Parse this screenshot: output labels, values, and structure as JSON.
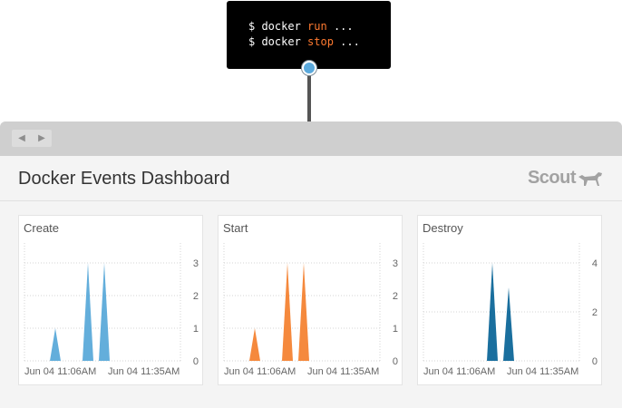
{
  "terminal": {
    "lines": [
      {
        "prompt": "$ docker",
        "command": "run",
        "suffix": "..."
      },
      {
        "prompt": "$ docker",
        "command": "stop",
        "suffix": "..."
      }
    ]
  },
  "window": {
    "nav": {
      "back_icon": "triangle-left-icon",
      "forward_icon": "triangle-right-icon"
    },
    "page_title": "Docker Events Dashboard",
    "logo_text": "Scout",
    "logo_icon": "dog-icon"
  },
  "chart_data": [
    {
      "type": "area",
      "title": "Create",
      "color": "#63aedb",
      "x_tick_labels": [
        "Jun 04 11:06AM",
        "Jun 04 11:35AM"
      ],
      "y_ticks": [
        0,
        1,
        2,
        3
      ],
      "ylim": [
        0,
        3
      ],
      "spikes": [
        1,
        3,
        3
      ]
    },
    {
      "type": "area",
      "title": "Start",
      "color": "#f5893d",
      "x_tick_labels": [
        "Jun 04 11:06AM",
        "Jun 04 11:35AM"
      ],
      "y_ticks": [
        0,
        1,
        2,
        3
      ],
      "ylim": [
        0,
        3
      ],
      "spikes": [
        1,
        3,
        3
      ]
    },
    {
      "type": "area",
      "title": "Destroy",
      "color": "#1a6f9e",
      "x_tick_labels": [
        "Jun 04 11:06AM",
        "Jun 04 11:35AM"
      ],
      "y_ticks": [
        0,
        2,
        4
      ],
      "ylim": [
        0,
        4
      ],
      "spikes": [
        4,
        3
      ]
    }
  ]
}
